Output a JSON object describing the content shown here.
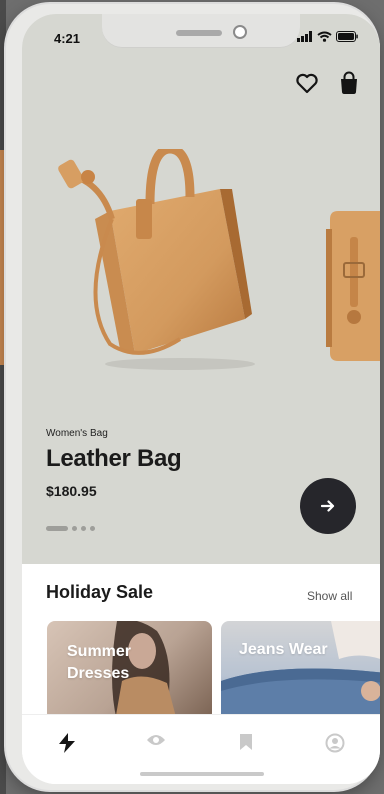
{
  "status_bar": {
    "time": "4:21"
  },
  "product": {
    "category": "Women's Bag",
    "name": "Leather Bag",
    "price": "$180.95"
  },
  "carousel": {
    "count": 4,
    "active_index": 0
  },
  "section": {
    "title": "Holiday Sale",
    "show_all": "Show all"
  },
  "cards": [
    {
      "label_line1": "Summer",
      "label_line2": "Dresses"
    },
    {
      "label": "Jeans Wear"
    }
  ],
  "nav": {
    "items": [
      "bolt-icon",
      "eye-icon",
      "bookmark-icon",
      "profile-icon"
    ],
    "active": "bolt-icon"
  },
  "colors": {
    "hero_bg": "#d6d7d1",
    "dark_button": "#26262b",
    "leather": "#d39a5e"
  }
}
